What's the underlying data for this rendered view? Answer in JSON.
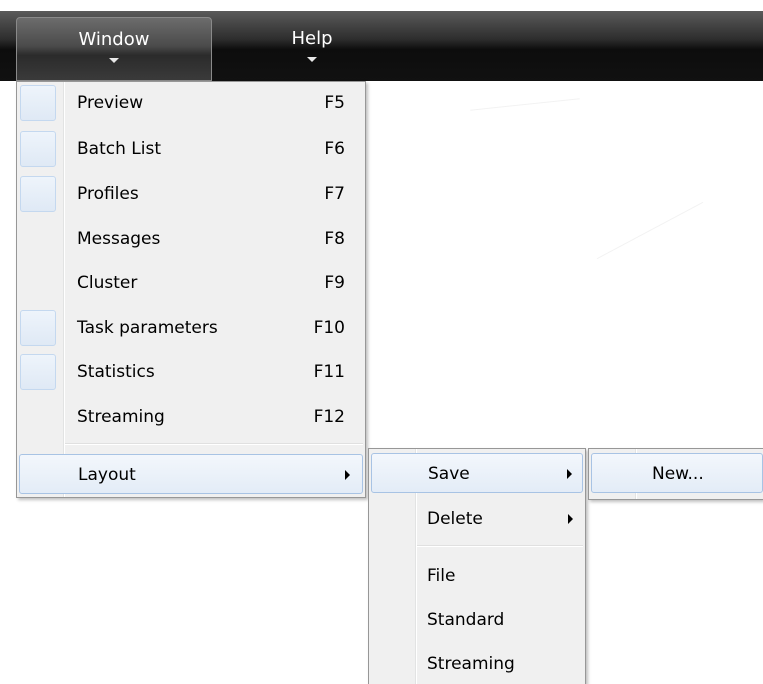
{
  "menubar": {
    "window_label": "Window",
    "help_label": "Help"
  },
  "window_menu": {
    "items": [
      {
        "label": "Preview",
        "shortcut": "F5"
      },
      {
        "label": "Batch List",
        "shortcut": "F6"
      },
      {
        "label": "Profiles",
        "shortcut": "F7"
      },
      {
        "label": "Messages",
        "shortcut": "F8"
      },
      {
        "label": "Cluster",
        "shortcut": "F9"
      },
      {
        "label": "Task parameters",
        "shortcut": "F10"
      },
      {
        "label": "Statistics",
        "shortcut": "F11"
      },
      {
        "label": "Streaming",
        "shortcut": "F12"
      }
    ],
    "layout_label": "Layout"
  },
  "layout_menu": {
    "save_label": "Save",
    "delete_label": "Delete",
    "file_label": "File",
    "standard_label": "Standard",
    "streaming_label": "Streaming"
  },
  "save_menu": {
    "new_label": "New..."
  }
}
